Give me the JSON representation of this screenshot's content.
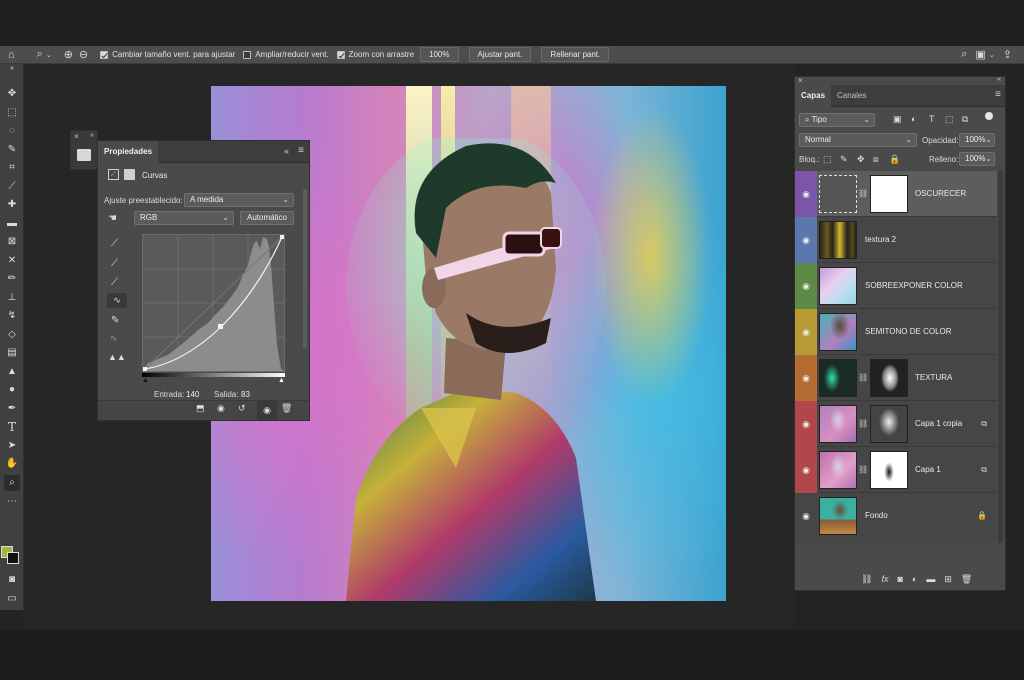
{
  "options_bar": {
    "resize_windows": "Cambiar tamaño vent. para ajustar",
    "zoom_all_windows": "Ampliar/reducir vent.",
    "scrubby_zoom": "Zoom con arrastre",
    "zoom_value": "100%",
    "fit_screen": "Ajustar pant.",
    "fill_screen": "Rellenar pant."
  },
  "properties": {
    "tab": "Propiedades",
    "adjustment": "Curvas",
    "preset_label": "Ajuste preestablecido:",
    "preset_value": "A medida",
    "channel": "RGB",
    "auto_button": "Automático",
    "input_label": "Entrada:",
    "input_value": "140",
    "output_label": "Salida:",
    "output_value": "83"
  },
  "layers_panel": {
    "tabs": [
      "Capas",
      "Canales"
    ],
    "filter_kind": "Tipo",
    "blend_mode": "Normal",
    "opacity_label": "Opacidad:",
    "opacity_value": "100%",
    "lock_label": "Bloq.:",
    "fill_label": "Relleno:",
    "fill_value": "100%",
    "layers": [
      {
        "name": "OSCURECER",
        "color": "#7a55a8",
        "selected": true
      },
      {
        "name": "textura 2",
        "color": "#5a78ad"
      },
      {
        "name": "SOBREEXPONER COLOR",
        "color": "#5d8a47"
      },
      {
        "name": "SEMITONO DE COLOR",
        "color": "#b89a34"
      },
      {
        "name": "TEXTURA",
        "color": "#b56c32"
      },
      {
        "name": "Capa 1 copia",
        "color": "#b1464b"
      },
      {
        "name": "Capa 1",
        "color": "#b1464b"
      },
      {
        "name": "Fondo",
        "color": "#4a4a4a"
      }
    ]
  },
  "colors": {
    "foreground": "#a8b43c",
    "background": "#111111"
  }
}
